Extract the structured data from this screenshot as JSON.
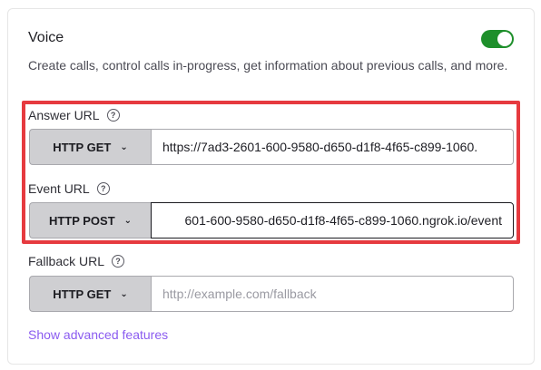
{
  "voice": {
    "title": "Voice",
    "enabled": true,
    "description": "Create calls, control calls in-progress, get information about previous calls, and more."
  },
  "answer": {
    "label": "Answer URL",
    "method": "HTTP GET",
    "value": "https://7ad3-2601-600-9580-d650-d1f8-4f65-c899-1060."
  },
  "event": {
    "label": "Event URL",
    "method": "HTTP POST",
    "value": "601-600-9580-d650-d1f8-4f65-c899-1060.ngrok.io/event"
  },
  "fallback": {
    "label": "Fallback URL",
    "method": "HTTP GET",
    "placeholder": "http://example.com/fallback"
  },
  "advanced_link": "Show advanced features",
  "icons": {
    "help": "question-circle-icon",
    "chevron": "chevron-down-icon"
  },
  "colors": {
    "toggle_on": "#1e8f2b",
    "highlight": "#e63a3f",
    "link": "#8b5cf0"
  }
}
